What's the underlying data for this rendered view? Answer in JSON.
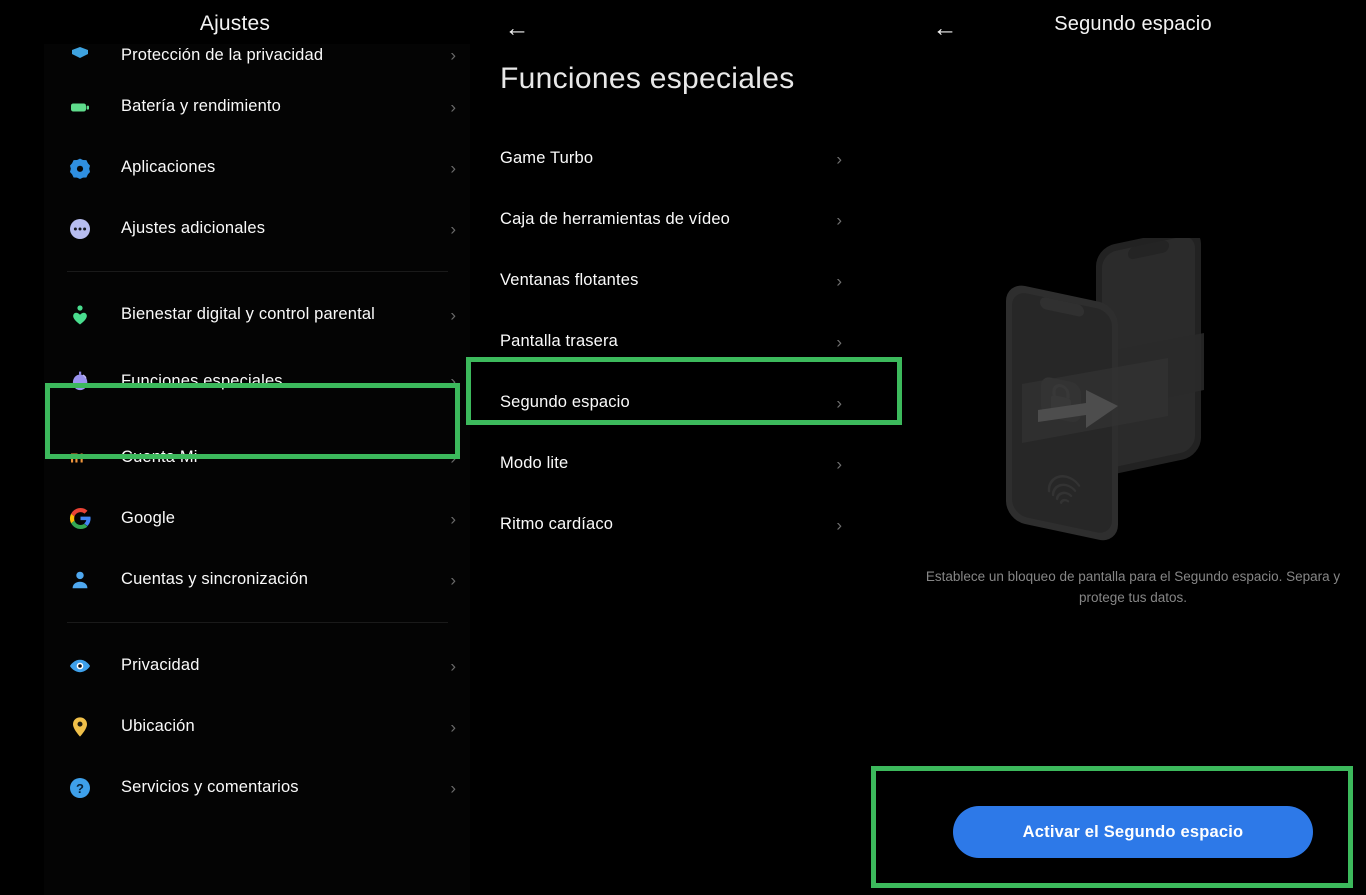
{
  "sidebar": {
    "title": "Ajustes",
    "items": [
      {
        "label": "Protección de la privacidad",
        "icon": "privacy-shield-icon",
        "chevron": "›",
        "partial": true
      },
      {
        "label": "Batería y rendimiento",
        "icon": "battery-icon",
        "chevron": "›"
      },
      {
        "label": "Aplicaciones",
        "icon": "apps-gear-icon",
        "chevron": "›"
      },
      {
        "label": "Ajustes adicionales",
        "icon": "additional-settings-icon",
        "chevron": "›"
      },
      {
        "label": "Bienestar digital y control parental",
        "icon": "digital-wellbeing-icon",
        "chevron": "›"
      },
      {
        "label": "Funciones especiales",
        "icon": "special-features-icon",
        "chevron": "›",
        "highlighted": true
      },
      {
        "label": "Cuenta Mi",
        "icon": "mi-account-icon",
        "chevron": "›"
      },
      {
        "label": "Google",
        "icon": "google-icon",
        "chevron": "›"
      },
      {
        "label": "Cuentas y sincronización",
        "icon": "accounts-sync-icon",
        "chevron": "›"
      },
      {
        "label": "Privacidad",
        "icon": "eye-privacy-icon",
        "chevron": "›"
      },
      {
        "label": "Ubicación",
        "icon": "location-pin-icon",
        "chevron": "›"
      },
      {
        "label": "Servicios y comentarios",
        "icon": "help-question-icon",
        "chevron": "›"
      }
    ]
  },
  "middle": {
    "back_icon": "←",
    "title": "Funciones especiales",
    "items": [
      {
        "label": "Game Turbo",
        "chevron": "›"
      },
      {
        "label": "Caja de herramientas de vídeo",
        "chevron": "›"
      },
      {
        "label": "Ventanas flotantes",
        "chevron": "›"
      },
      {
        "label": "Pantalla trasera",
        "chevron": "›"
      },
      {
        "label": "Segundo espacio",
        "chevron": "›",
        "highlighted": true
      },
      {
        "label": "Modo lite",
        "chevron": "›"
      },
      {
        "label": "Ritmo cardíaco",
        "chevron": "›"
      }
    ]
  },
  "right": {
    "back_icon": "←",
    "title": "Segundo espacio",
    "illustration": "two-phones-lock-arrow-fingerprint-illustration",
    "description": "Establece un bloqueo de pantalla para el Segundo espacio. Separa y protege tus datos.",
    "cta_label": "Activar el Segundo espacio"
  },
  "annotations": {
    "color": "#3cb95c",
    "boxes": [
      {
        "name": "funciones-especiales-sidebar-highlight"
      },
      {
        "name": "segundo-espacio-row-highlight"
      },
      {
        "name": "activar-segundo-espacio-button-highlight"
      }
    ]
  },
  "colors": {
    "background": "#000000",
    "accent_blue": "#2d79e8",
    "highlight_green": "#3cb95c",
    "primary_text": "#fafafa",
    "secondary_text": "#868686"
  }
}
